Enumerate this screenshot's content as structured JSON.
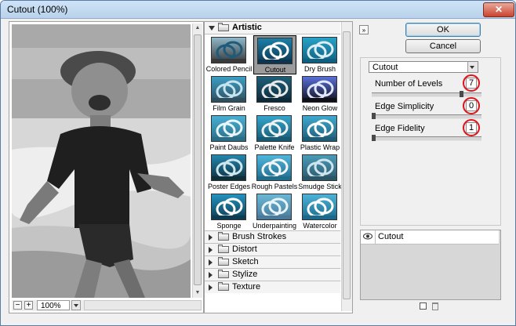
{
  "window": {
    "title": "Cutout (100%)",
    "close_glyph": "✕"
  },
  "preview": {
    "zoom": "100%",
    "zoom_out_glyph": "−",
    "zoom_in_glyph": "+"
  },
  "gallery": {
    "open_category": "Artistic",
    "filters": [
      {
        "label": "Colored Pencil",
        "selected": false
      },
      {
        "label": "Cutout",
        "selected": true
      },
      {
        "label": "Dry Brush",
        "selected": false
      },
      {
        "label": "Film Grain",
        "selected": false
      },
      {
        "label": "Fresco",
        "selected": false
      },
      {
        "label": "Neon Glow",
        "selected": false
      },
      {
        "label": "Paint Daubs",
        "selected": false
      },
      {
        "label": "Palette Knife",
        "selected": false
      },
      {
        "label": "Plastic Wrap",
        "selected": false
      },
      {
        "label": "Poster Edges",
        "selected": false
      },
      {
        "label": "Rough Pastels",
        "selected": false
      },
      {
        "label": "Smudge Stick",
        "selected": false
      },
      {
        "label": "Sponge",
        "selected": false
      },
      {
        "label": "Underpainting",
        "selected": false
      },
      {
        "label": "Watercolor",
        "selected": false
      }
    ],
    "closed_categories": [
      "Brush Strokes",
      "Distort",
      "Sketch",
      "Stylize",
      "Texture"
    ]
  },
  "buttons": {
    "ok": "OK",
    "cancel": "Cancel",
    "collapse_glyph": "»"
  },
  "settings": {
    "filter": "Cutout",
    "params": [
      {
        "label": "Number of Levels",
        "value": "7",
        "fraction": 0.83
      },
      {
        "label": "Edge Simplicity",
        "value": "0",
        "fraction": 0.0
      },
      {
        "label": "Edge Fidelity",
        "value": "1",
        "fraction": 0.0
      }
    ]
  },
  "layers": {
    "items": [
      {
        "name": "Cutout"
      }
    ]
  },
  "colors": {
    "highlight_ring": "#e1121a",
    "selected_thumb_bg": "#9b9b9b",
    "ok_border": "#3c7fb1"
  }
}
